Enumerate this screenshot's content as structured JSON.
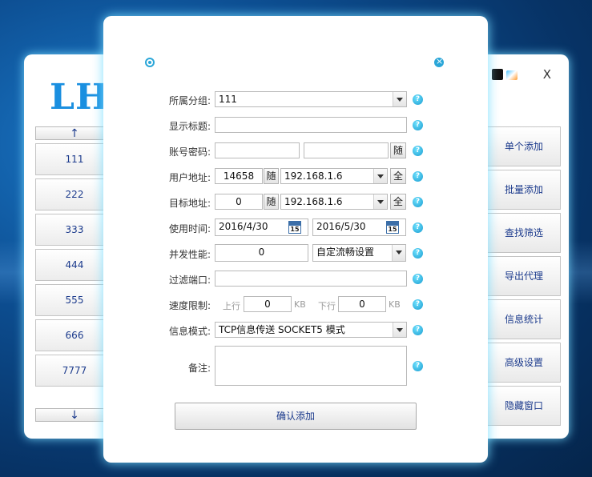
{
  "main": {
    "logo": "LH",
    "close": "X",
    "left_list": {
      "up": "↑",
      "down": "↓",
      "items": [
        "111",
        "222",
        "333",
        "444",
        "555",
        "666",
        "7777"
      ]
    },
    "right_buttons": [
      "单个添加",
      "批量添加",
      "查找筛选",
      "导出代理",
      "信息统计",
      "高级设置",
      "隐藏窗口"
    ]
  },
  "dialog": {
    "group": {
      "label": "所属分组:",
      "value": "111"
    },
    "title": {
      "label": "显示标题:",
      "value": ""
    },
    "account": {
      "label": "账号密码:",
      "user": "",
      "pass": "",
      "random": "随"
    },
    "user_addr": {
      "label": "用户地址:",
      "port": "14658",
      "random": "随",
      "ip": "192.168.1.6",
      "all": "全"
    },
    "target_addr": {
      "label": "目标地址:",
      "port": "0",
      "random": "随",
      "ip": "192.168.1.6",
      "all": "全"
    },
    "usage_time": {
      "label": "使用时间:",
      "start": "2016/4/30",
      "end": "2016/5/30",
      "cal_day": "15"
    },
    "concurrency": {
      "label": "并发性能:",
      "value": "0",
      "mode": "自定流畅设置"
    },
    "filter_port": {
      "label": "过滤端口:",
      "value": ""
    },
    "speed": {
      "label": "速度限制:",
      "up_label": "上行",
      "up_value": "0",
      "down_label": "下行",
      "down_value": "0",
      "unit": "KB"
    },
    "info_mode": {
      "label": "信息模式:",
      "value": "TCP信息传送 SOCKET5 模式"
    },
    "remark": {
      "label": "备注:",
      "value": ""
    },
    "help": "?",
    "confirm": "确认添加"
  },
  "colors": {
    "accent": "#1a8fe0",
    "help": "#1a9cd0",
    "glow": "#78dcff"
  }
}
